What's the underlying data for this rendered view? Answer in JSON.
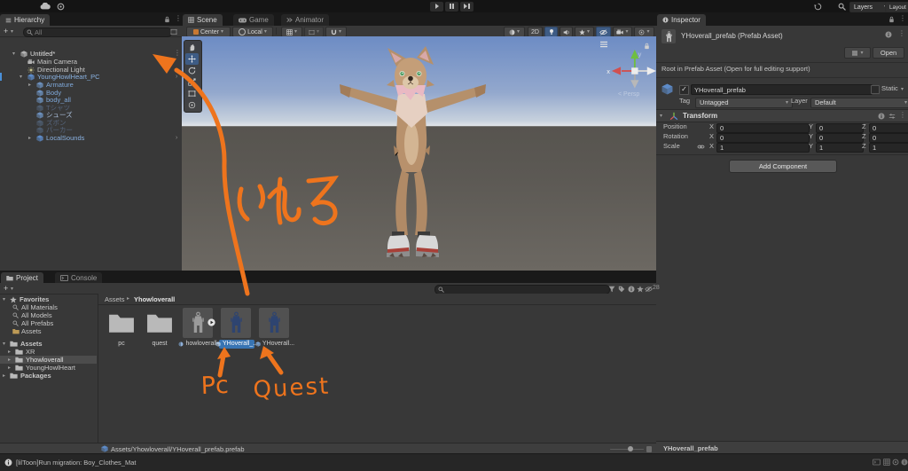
{
  "topbar": {
    "layers": "Layers",
    "layout": "Layout"
  },
  "hierarchy": {
    "tab": "Hierarchy",
    "create_button": "+",
    "search_placeholder": "All",
    "items": [
      {
        "label": "Untitled*"
      },
      {
        "label": "Main Camera"
      },
      {
        "label": "Directional Light"
      },
      {
        "label": "YoungHowlHeart_PC"
      },
      {
        "label": "Armature"
      },
      {
        "label": "Body"
      },
      {
        "label": "body_all"
      },
      {
        "label": "Tシャツ"
      },
      {
        "label": "シューズ"
      },
      {
        "label": "ズボン"
      },
      {
        "label": "パーカー"
      },
      {
        "label": "LocalSounds"
      }
    ]
  },
  "scene": {
    "tab_scene": "Scene",
    "tab_game": "Game",
    "tab_animator": "Animator",
    "pivot": "Center",
    "orientation": "Local",
    "mode_2d": "2D",
    "gizmo_x": "x",
    "gizmo_y": "y",
    "projection": "< Persp"
  },
  "inspector": {
    "tab": "Inspector",
    "title": "YHoverall_prefab (Prefab Asset)",
    "open_button": "Open",
    "root_note": "Root in Prefab Asset (Open for full editing support)",
    "name": "YHoverall_prefab",
    "static_label": "Static",
    "tag_label": "Tag",
    "tag_value": "Untagged",
    "layer_label": "Layer",
    "layer_value": "Default",
    "transform_title": "Transform",
    "axis_x": "X",
    "axis_y": "Y",
    "axis_z": "Z",
    "rows": [
      {
        "label": "Position",
        "x": "0",
        "y": "0",
        "z": "0"
      },
      {
        "label": "Rotation",
        "x": "0",
        "y": "0",
        "z": "0"
      },
      {
        "label": "Scale",
        "x": "1",
        "y": "1",
        "z": "1"
      }
    ],
    "add_component": "Add Component",
    "preview_title": "YHoverall_prefab"
  },
  "project": {
    "tab_project": "Project",
    "tab_console": "Console",
    "favorites_header": "Favorites",
    "favorites": [
      {
        "label": "All Materials"
      },
      {
        "label": "All Models"
      },
      {
        "label": "All Prefabs"
      },
      {
        "label": "Assets"
      }
    ],
    "assets_root": "Assets",
    "folders": [
      {
        "label": "XR"
      },
      {
        "label": "Yhowloverall"
      },
      {
        "label": "YoungHowlHeart"
      }
    ],
    "packages_root": "Packages",
    "breadcrumb_root": "Assets",
    "breadcrumb_current": "Yhowloverall",
    "items": [
      {
        "label": "pc"
      },
      {
        "label": "quest"
      },
      {
        "label": "howloverall"
      },
      {
        "label": "YHoverall_..."
      },
      {
        "label": "YHoverall..."
      }
    ],
    "selected_path": "Assets/Yhowloverall/YHoverall_prefab.prefab",
    "hidden_count": "28"
  },
  "statusbar": {
    "message": "[lilToon]Run migration: Boy_Clothes_Mat"
  },
  "annotations": {
    "ireru": "いれる",
    "pc": "Pc",
    "quest": "Quest"
  },
  "colors": {
    "annotation": "#ee741d",
    "prefab_text": "#7fa8d9",
    "selection": "#3874b3"
  }
}
